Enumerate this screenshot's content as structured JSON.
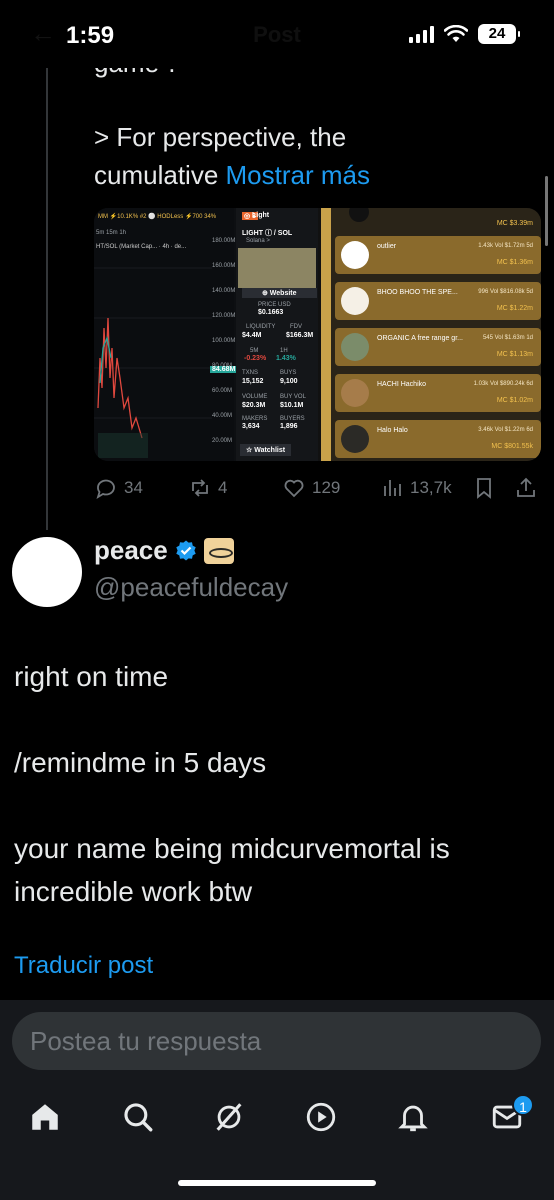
{
  "status": {
    "time": "1:59",
    "battery": "24"
  },
  "header": {
    "title": "Post",
    "back": "←"
  },
  "quoted": {
    "line1": "game\".",
    "line2": "> For perspective, the",
    "line3": "cumulative",
    "more": "Mostrar más"
  },
  "media": {
    "chart_tabs": "MM ⚡10.1K%   #2 ⚪ HODLess ⚡700 34%",
    "chart_pair": "HT/SOL (Market Cap... · 4h · de...",
    "chart_intervals": "5m  15m  1h",
    "price_ticks": [
      "180.00M",
      "160.00M",
      "140.00M",
      "120.00M",
      "100.00M",
      "80.00M",
      "60.00M",
      "40.00M",
      "20.00M"
    ],
    "price_marker": "84.68M",
    "app_title": "LIGHT ⓘ / SOL",
    "app_chain": "Solana >",
    "website": "⊕ Website",
    "price_usd_label": "PRICE USD",
    "price_usd": "$0.1663",
    "liquidity_label": "LIQUIDITY",
    "liquidity": "$4.4M",
    "fdv_label": "FDV",
    "fdv": "$166.3M",
    "m5_label": "5M",
    "m5": "-0.23%",
    "h1_label": "1H",
    "h1": "1.43%",
    "txns_label": "TXNS",
    "txns": "15,152",
    "buys_label": "BUYS",
    "buys": "9,100",
    "volume_label": "VOLUME",
    "volume": "$20.3M",
    "buyvol_label": "BUY VOL",
    "buyvol": "$10.1M",
    "makers_label": "MAKERS",
    "makers": "3,634",
    "buyers_label": "BUYERS",
    "buyers": "1,896",
    "watchlist": "☆ Watchlist",
    "light_tab": "Light",
    "top_mc": "MC $3.39m",
    "coins": [
      {
        "name": "outlier",
        "stat": "1.43k  Vol $1.72m  5d",
        "mc": "MC $1.36m"
      },
      {
        "name": "BHOO  BHOO THE SPE...",
        "stat": "996  Vol $816.08k  5d",
        "mc": "MC $1.22m"
      },
      {
        "name": "ORGANIC  A free range gr...",
        "stat": "545  Vol $1.63m  1d",
        "mc": "MC $1.13m"
      },
      {
        "name": "HACHI  Hachiko",
        "stat": "1.03k  Vol $890.24k  6d",
        "mc": "MC $1.02m"
      },
      {
        "name": "Halo  Halo",
        "stat": "3.46k  Vol $1.22m  6d",
        "mc": "MC $801.55k"
      }
    ]
  },
  "actions": {
    "replies": "34",
    "reposts": "4",
    "likes": "129",
    "views": "13,7k"
  },
  "reply": {
    "name": "peace",
    "handle": "@peacefuldecay",
    "line1": "right on time",
    "line2": "/remindme in 5 days",
    "line3": "your name being midcurvemortal is",
    "line4": "incredible work btw",
    "translate": "Traducir post"
  },
  "composer": {
    "placeholder": "Postea tu respuesta"
  },
  "nav": {
    "messages_badge": "1"
  },
  "colors": {
    "accent": "#1d9bf0",
    "muted": "#71767b",
    "text": "#e7e9ea",
    "background": "#000000"
  }
}
